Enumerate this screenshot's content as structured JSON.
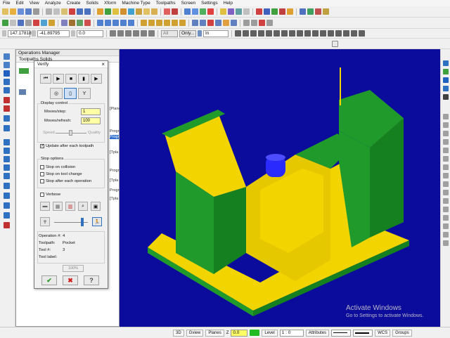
{
  "menu": [
    "File",
    "Edit",
    "View",
    "Analyze",
    "Create",
    "Solids",
    "Xform",
    "Machine Type",
    "Toolpaths",
    "Screen",
    "Settings",
    "Help"
  ],
  "toolbar3": {
    "x_value": "147.17818",
    "y_value": "-41.89795",
    "z_value": "0.0",
    "filter_all": "All",
    "filter_only": "Only...",
    "filter_in": "In"
  },
  "ops_manager": {
    "title": "Operations Manager",
    "tabs_label": "Toolpaths  Solids",
    "side_texts": [
      "[Plane",
      "Progr",
      "Progr",
      "[Tpla",
      "Progr",
      "[Tpla",
      "Progr",
      "[Tpla"
    ]
  },
  "verify": {
    "title": "Verify",
    "close": "×",
    "display_control_label": "Display control",
    "moves_step_label": "Moves/step:",
    "moves_step_value": "1",
    "moves_refresh_label": "Moves/refresh:",
    "moves_refresh_value": "100",
    "speed_label": "Speed",
    "quality_label": "Quality",
    "update_label": "Update after each toolpath",
    "update_checked": true,
    "stop_options_label": "Stop options",
    "stop_collision_label": "Stop on collision",
    "stop_tool_change_label": "Stop on tool change",
    "stop_each_op_label": "Stop after each operation",
    "verbose_label": "Verbose",
    "operation_label": "Operation #:",
    "operation_value": "4",
    "toolpath_label": "Toolpath:",
    "toolpath_value": "Pocket",
    "tool_label": "Tool #:",
    "tool_value": "3",
    "tool_label_label": "Tool label:",
    "tool_label_value": "",
    "progress_text": "100%",
    "progress": 1.0
  },
  "watermark": {
    "line1": "Activate Windows",
    "line2": "Go to Settings to activate Windows."
  },
  "statusbar": {
    "view_3d": "3D",
    "gview": "Gview",
    "planes": "Planes",
    "z_label": "Z",
    "z_value": "0.0",
    "level_label": "Level",
    "level_value": "1 : 0",
    "attributes": "Attributes",
    "wcs": "WCS",
    "groups": "Groups"
  },
  "colors": {
    "viewport_bg": "#0c0c9c",
    "part_yellow": "#f2d400",
    "part_green": "#1f9a2b",
    "tool_blue": "#2a2aff",
    "yellow_field": "#ffffa6"
  }
}
